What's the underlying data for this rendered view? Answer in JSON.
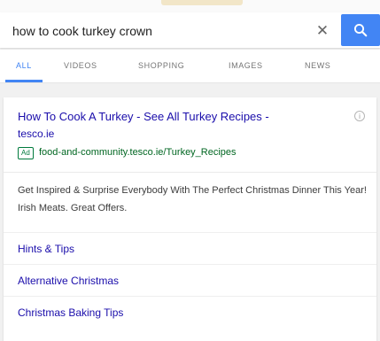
{
  "search": {
    "query": "how to cook turkey crown",
    "clear_icon": "close-icon",
    "search_icon": "search-icon",
    "accent_color": "#4285f4"
  },
  "tabs": [
    {
      "label": "ALL",
      "active": true
    },
    {
      "label": "VIDEOS",
      "active": false
    },
    {
      "label": "SHOPPING",
      "active": false
    },
    {
      "label": "IMAGES",
      "active": false
    },
    {
      "label": "NEWS",
      "active": false
    }
  ],
  "result": {
    "title": "How To Cook A Turkey - See All Turkey Recipes -",
    "domain": "tesco.ie",
    "badge": "Ad",
    "display_url": "food-and-community.tesco.ie/Turkey_Recipes",
    "description": "Get Inspired & Surprise Everybody With The Perfect Christmas Dinner This Year! Irish Meats. Great Offers.",
    "sitelinks": [
      "Hints & Tips",
      "Alternative Christmas",
      "Christmas Baking Tips"
    ],
    "link_color": "#1a0dab",
    "url_color": "#006621"
  }
}
